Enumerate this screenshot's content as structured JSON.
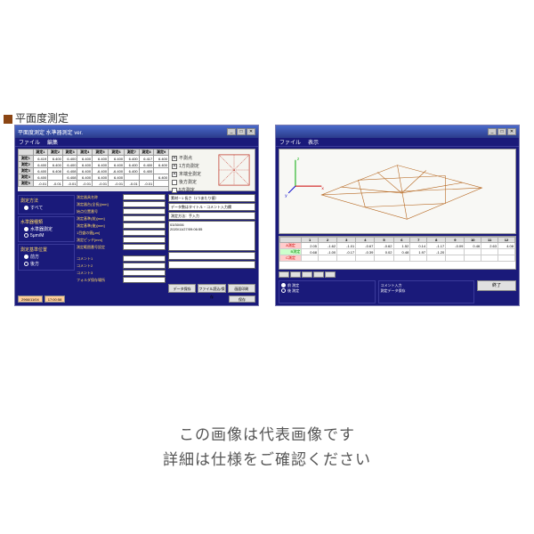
{
  "header": "平面度測定",
  "caption": {
    "line1": "この画像は代表画像です",
    "line2": "詳細は仕様をご確認ください"
  },
  "win1": {
    "title": "平面度測定 水準器測定 ver.",
    "menu": [
      "ファイル",
      "編集"
    ],
    "grid": {
      "cols": [
        "",
        "測定1",
        "測定2",
        "測定3",
        "測定4",
        "測定5",
        "測定6",
        "測定7",
        "測定8",
        "測定9"
      ],
      "rows": [
        [
          "測定1",
          "6.419",
          "6.400",
          "6.400",
          "6.400",
          "6.400",
          "6.400",
          "6.400",
          "6.417",
          "6.400"
        ],
        [
          "測定2",
          "6.400",
          "6.400",
          "6.400",
          "6.400",
          "6.400",
          "6.400",
          "6.400",
          "6.400",
          "6.400"
        ],
        [
          "測定3",
          "6.400",
          "6.408",
          "6.408",
          "6.400",
          "-6.400",
          "-6.400",
          "6.400",
          "6.400",
          ""
        ],
        [
          "測定4",
          "6.400",
          "",
          "6.408",
          "6.400",
          "6.400",
          "6.400",
          "",
          "",
          "6.400"
        ],
        [
          "測定5",
          "-0.01",
          "-0.01",
          "-0.01",
          "-0.01",
          "-0.01",
          "-0.01",
          "-0.01",
          "-0.01",
          ""
        ]
      ]
    },
    "diag_opts": [
      "不測点",
      "1方向測定",
      "末端全測定",
      "後方測定",
      "5方測定"
    ],
    "left": {
      "g1_label": "測定方法",
      "g1_opts": [
        "すべて"
      ],
      "g2_label": "水準器種類",
      "g2_opts": [
        "水準器測定",
        "5μm/M"
      ],
      "g3_label": "測定基準位置",
      "g3_opts": [
        "前方",
        "後方"
      ]
    },
    "mid": {
      "rows": [
        {
          "l": "測定器具名称",
          "v": ""
        },
        {
          "l": "測定器台(全長)[mm]",
          "v": ""
        },
        {
          "l": "始点位置番号",
          "v": ""
        },
        {
          "l": "測定基準(前)[mm]",
          "v": ""
        },
        {
          "l": "測定基準(後)[mm]",
          "v": ""
        },
        {
          "l": "1目盛の値[μm]",
          "v": ""
        },
        {
          "l": "測定ピッチ[mm]",
          "v": ""
        },
        {
          "l": "測定範囲番号設定",
          "v": ""
        }
      ],
      "rows2": [
        {
          "l": "コメント1",
          "v": ""
        },
        {
          "l": "コメント2",
          "v": ""
        },
        {
          "l": "コメント3",
          "v": ""
        },
        {
          "l": "フォルダ保存場所",
          "v": ""
        }
      ]
    },
    "right": {
      "inputs": [
        "素材－1 長さ（1つあたり値）",
        "データ数はタイトル・コメント入力欄",
        "測定方法：手入力"
      ],
      "tall": "03/30/06\\n2020/11/27/09:06:55"
    },
    "btn_row": [
      "データ保存",
      "ファイル読込/保存",
      "画面印刷"
    ],
    "footer": [
      "2966/11/04",
      "17:00:58",
      "",
      "保存"
    ]
  },
  "win2": {
    "title": "",
    "menu": [
      "ファイル",
      "表示"
    ],
    "data": {
      "cols": [
        "",
        "1",
        "2",
        "3",
        "4",
        "5",
        "6",
        "7",
        "8",
        "9",
        "10",
        "11",
        "12"
      ],
      "rows": [
        [
          "A測定",
          "2.05",
          "-1.62",
          "-1.01",
          "-0.67",
          "-0.62",
          "1.52",
          "0.14",
          "-1.17",
          "-0.09",
          "0.46",
          "2.63",
          "4.08"
        ],
        [
          "B測定",
          "0.68",
          "-1.00",
          "-0.17",
          "-0.39",
          "0.02",
          "0.48",
          "1.97",
          "-1.20",
          "",
          "",
          "",
          ""
        ],
        [
          "C測定",
          "",
          "",
          "",
          "",
          "",
          "",
          "",
          "",
          "",
          "",
          "",
          ""
        ]
      ]
    },
    "bot": {
      "p1": [
        "前 測定",
        "後 測定"
      ],
      "p2": [
        "コメント入力",
        "測定データ保存"
      ],
      "btn": "終了"
    }
  }
}
